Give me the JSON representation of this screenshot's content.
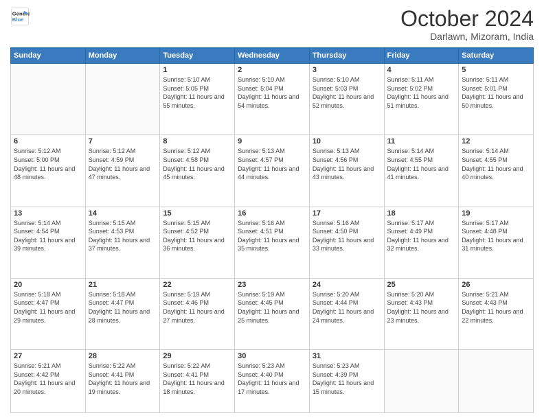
{
  "header": {
    "logo_line1": "General",
    "logo_line2": "Blue",
    "month": "October 2024",
    "location": "Darlawn, Mizoram, India"
  },
  "weekdays": [
    "Sunday",
    "Monday",
    "Tuesday",
    "Wednesday",
    "Thursday",
    "Friday",
    "Saturday"
  ],
  "weeks": [
    [
      {
        "day": "",
        "info": ""
      },
      {
        "day": "",
        "info": ""
      },
      {
        "day": "1",
        "info": "Sunrise: 5:10 AM\nSunset: 5:05 PM\nDaylight: 11 hours and 55 minutes."
      },
      {
        "day": "2",
        "info": "Sunrise: 5:10 AM\nSunset: 5:04 PM\nDaylight: 11 hours and 54 minutes."
      },
      {
        "day": "3",
        "info": "Sunrise: 5:10 AM\nSunset: 5:03 PM\nDaylight: 11 hours and 52 minutes."
      },
      {
        "day": "4",
        "info": "Sunrise: 5:11 AM\nSunset: 5:02 PM\nDaylight: 11 hours and 51 minutes."
      },
      {
        "day": "5",
        "info": "Sunrise: 5:11 AM\nSunset: 5:01 PM\nDaylight: 11 hours and 50 minutes."
      }
    ],
    [
      {
        "day": "6",
        "info": "Sunrise: 5:12 AM\nSunset: 5:00 PM\nDaylight: 11 hours and 48 minutes."
      },
      {
        "day": "7",
        "info": "Sunrise: 5:12 AM\nSunset: 4:59 PM\nDaylight: 11 hours and 47 minutes."
      },
      {
        "day": "8",
        "info": "Sunrise: 5:12 AM\nSunset: 4:58 PM\nDaylight: 11 hours and 45 minutes."
      },
      {
        "day": "9",
        "info": "Sunrise: 5:13 AM\nSunset: 4:57 PM\nDaylight: 11 hours and 44 minutes."
      },
      {
        "day": "10",
        "info": "Sunrise: 5:13 AM\nSunset: 4:56 PM\nDaylight: 11 hours and 43 minutes."
      },
      {
        "day": "11",
        "info": "Sunrise: 5:14 AM\nSunset: 4:55 PM\nDaylight: 11 hours and 41 minutes."
      },
      {
        "day": "12",
        "info": "Sunrise: 5:14 AM\nSunset: 4:55 PM\nDaylight: 11 hours and 40 minutes."
      }
    ],
    [
      {
        "day": "13",
        "info": "Sunrise: 5:14 AM\nSunset: 4:54 PM\nDaylight: 11 hours and 39 minutes."
      },
      {
        "day": "14",
        "info": "Sunrise: 5:15 AM\nSunset: 4:53 PM\nDaylight: 11 hours and 37 minutes."
      },
      {
        "day": "15",
        "info": "Sunrise: 5:15 AM\nSunset: 4:52 PM\nDaylight: 11 hours and 36 minutes."
      },
      {
        "day": "16",
        "info": "Sunrise: 5:16 AM\nSunset: 4:51 PM\nDaylight: 11 hours and 35 minutes."
      },
      {
        "day": "17",
        "info": "Sunrise: 5:16 AM\nSunset: 4:50 PM\nDaylight: 11 hours and 33 minutes."
      },
      {
        "day": "18",
        "info": "Sunrise: 5:17 AM\nSunset: 4:49 PM\nDaylight: 11 hours and 32 minutes."
      },
      {
        "day": "19",
        "info": "Sunrise: 5:17 AM\nSunset: 4:48 PM\nDaylight: 11 hours and 31 minutes."
      }
    ],
    [
      {
        "day": "20",
        "info": "Sunrise: 5:18 AM\nSunset: 4:47 PM\nDaylight: 11 hours and 29 minutes."
      },
      {
        "day": "21",
        "info": "Sunrise: 5:18 AM\nSunset: 4:47 PM\nDaylight: 11 hours and 28 minutes."
      },
      {
        "day": "22",
        "info": "Sunrise: 5:19 AM\nSunset: 4:46 PM\nDaylight: 11 hours and 27 minutes."
      },
      {
        "day": "23",
        "info": "Sunrise: 5:19 AM\nSunset: 4:45 PM\nDaylight: 11 hours and 25 minutes."
      },
      {
        "day": "24",
        "info": "Sunrise: 5:20 AM\nSunset: 4:44 PM\nDaylight: 11 hours and 24 minutes."
      },
      {
        "day": "25",
        "info": "Sunrise: 5:20 AM\nSunset: 4:43 PM\nDaylight: 11 hours and 23 minutes."
      },
      {
        "day": "26",
        "info": "Sunrise: 5:21 AM\nSunset: 4:43 PM\nDaylight: 11 hours and 22 minutes."
      }
    ],
    [
      {
        "day": "27",
        "info": "Sunrise: 5:21 AM\nSunset: 4:42 PM\nDaylight: 11 hours and 20 minutes."
      },
      {
        "day": "28",
        "info": "Sunrise: 5:22 AM\nSunset: 4:41 PM\nDaylight: 11 hours and 19 minutes."
      },
      {
        "day": "29",
        "info": "Sunrise: 5:22 AM\nSunset: 4:41 PM\nDaylight: 11 hours and 18 minutes."
      },
      {
        "day": "30",
        "info": "Sunrise: 5:23 AM\nSunset: 4:40 PM\nDaylight: 11 hours and 17 minutes."
      },
      {
        "day": "31",
        "info": "Sunrise: 5:23 AM\nSunset: 4:39 PM\nDaylight: 11 hours and 15 minutes."
      },
      {
        "day": "",
        "info": ""
      },
      {
        "day": "",
        "info": ""
      }
    ]
  ]
}
